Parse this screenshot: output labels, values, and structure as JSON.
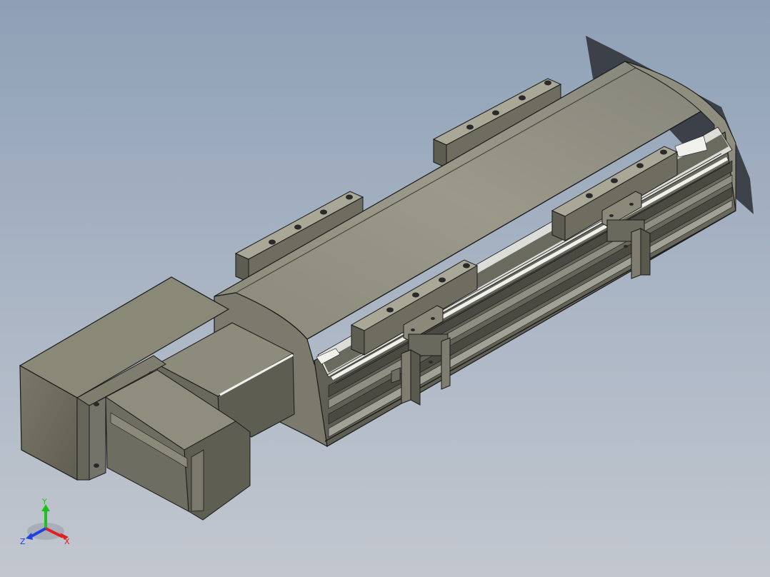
{
  "view": {
    "background_top": "#8ea0b6",
    "background_bottom": "#c2c7cf",
    "model_color": "#7d7b6b",
    "rail_highlight": "#e8e8e6"
  },
  "triad": {
    "x_label": "X",
    "y_label": "Y",
    "z_label": "Z",
    "x_color": "#e02020",
    "y_color": "#20c020",
    "z_color": "#2040e0"
  }
}
